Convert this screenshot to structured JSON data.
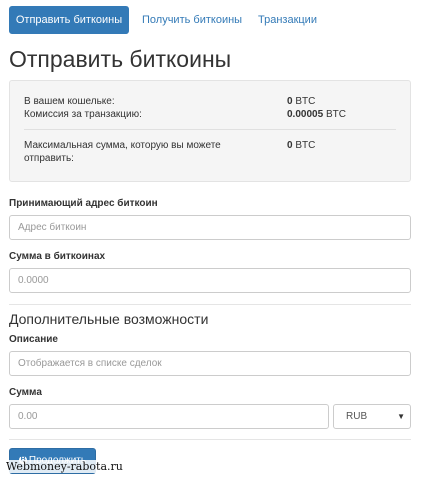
{
  "tabs": [
    {
      "label": "Отправить биткоины",
      "active": true
    },
    {
      "label": "Получить биткоины",
      "active": false
    },
    {
      "label": "Транзакции",
      "active": false
    }
  ],
  "page_title": "Отправить биткоины",
  "summary": {
    "wallet_label": "В вашем кошельке:",
    "wallet_amount": "0",
    "wallet_unit": "BTC",
    "fee_label": "Комиссия за транзакцию:",
    "fee_amount": "0.00005",
    "fee_unit": "BTC",
    "max_label_line1": "Максимальная сумма, которую вы можете",
    "max_label_line2": "отправить:",
    "max_amount": "0",
    "max_unit": "BTC"
  },
  "form": {
    "address_label": "Принимающий адрес биткоин",
    "address_placeholder": "Адрес биткоин",
    "btc_amount_label": "Сумма в биткоинах",
    "btc_amount_placeholder": "0.0000"
  },
  "extra": {
    "section_title": "Дополнительные возможности",
    "description_label": "Описание",
    "description_placeholder": "Отображается в списке сделок",
    "sum_label": "Сумма",
    "sum_placeholder": "0.00",
    "currency_selected": "RUB"
  },
  "continue_button": "Продолжить",
  "watermark": "Webmoney-rabota.ru",
  "colors": {
    "accent": "#337ab7"
  }
}
